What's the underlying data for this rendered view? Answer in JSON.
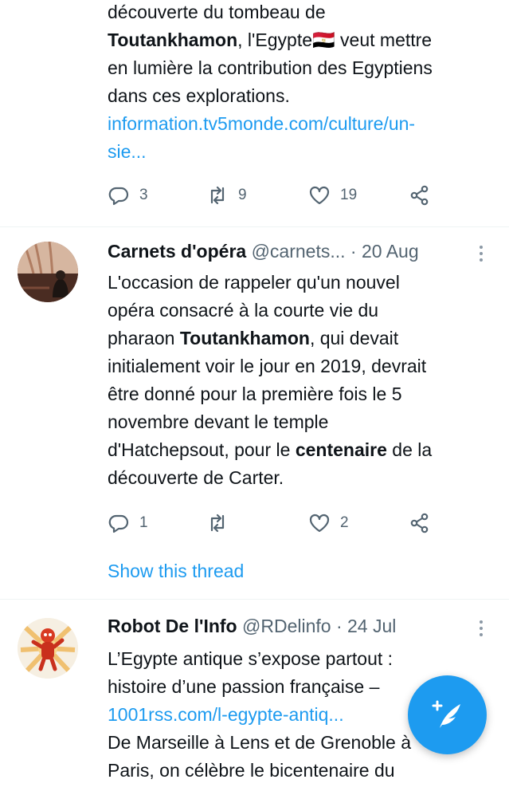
{
  "tweet1": {
    "line1": "découverte du tombeau de",
    "name_bold": "Toutankhamon",
    "line2_rest": ", l'Egypte",
    "flag": "🇪🇬",
    "line2_end": " veut mettre",
    "line3": "en lumière la contribution des Egyptiens",
    "line4": "dans ces explorations.",
    "link1": "information.tv5monde.com/culture/un-",
    "link2": "sie...",
    "replies": "3",
    "retweets": "9",
    "likes": "19"
  },
  "tweet2": {
    "name": "Carnets d'opéra",
    "handle": "@carnets...",
    "sep": " · ",
    "date": "20 Aug",
    "l1": "L'occasion de rappeler qu'un nouvel",
    "l2": "opéra consacré à la courte vie du",
    "l3_pre": "pharaon ",
    "l3_bold": "Toutankhamon",
    "l3_post": ", qui devait",
    "l4": "initialement voir le jour en 2019, devrait",
    "l5": "être donné pour la première fois le 5",
    "l6": "novembre devant le temple",
    "l7_pre": "d'Hatchepsout, pour le ",
    "l7_bold": "centenaire",
    "l7_post": " de la",
    "l8": "découverte de Carter.",
    "replies": "1",
    "likes": "2",
    "show_thread": "Show this thread"
  },
  "tweet3": {
    "name": "Robot De l'Info",
    "handle": "@RDelinfo",
    "sep": " · ",
    "date": "24 Jul",
    "l1": "L’Egypte antique s’expose partout :",
    "l2": "histoire d’une passion française –",
    "link": "1001rss.com/l-egypte-antiq...",
    "l4": "De Marseille à Lens et de Grenoble à",
    "l5": "Paris, on célèbre le bicentenaire du"
  },
  "icons": {
    "reply": "reply-icon",
    "retweet": "retweet-icon",
    "like": "heart-icon",
    "share": "share-icon",
    "more": "more-icon",
    "compose": "compose-tweet-icon"
  },
  "colors": {
    "accent": "#1d9bf0",
    "muted": "#536471"
  }
}
